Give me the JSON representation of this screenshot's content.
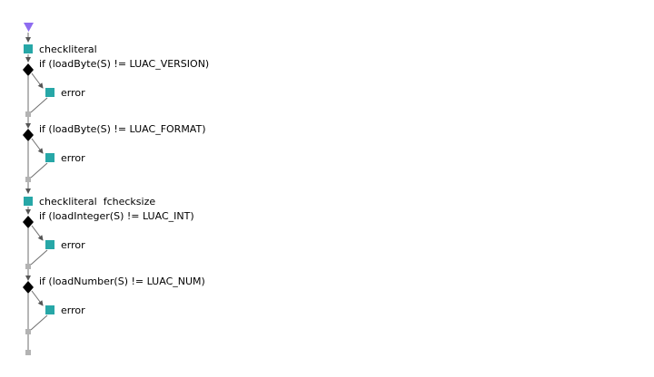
{
  "colors": {
    "start": "#8e6cf0",
    "action": "#27a7a7",
    "decision": "#000000",
    "merge": "#b3b3b3",
    "line": "#6e6e6e"
  },
  "flow": {
    "start_icon": "triangle-down-icon",
    "end_icon": "end-square-icon",
    "steps": [
      {
        "kind": "action",
        "label": "checkliteral"
      },
      {
        "kind": "decision",
        "label": "if (loadByte(S) != LUAC_VERSION)",
        "branch_label": "error"
      },
      {
        "kind": "decision",
        "label": "if (loadByte(S) != LUAC_FORMAT)",
        "branch_label": "error"
      },
      {
        "kind": "action",
        "label": "checkliteral  fchecksize"
      },
      {
        "kind": "decision",
        "label": "if (loadInteger(S) != LUAC_INT)",
        "branch_label": "error"
      },
      {
        "kind": "decision",
        "label": "if (loadNumber(S) != LUAC_NUM)",
        "branch_label": "error"
      }
    ]
  }
}
